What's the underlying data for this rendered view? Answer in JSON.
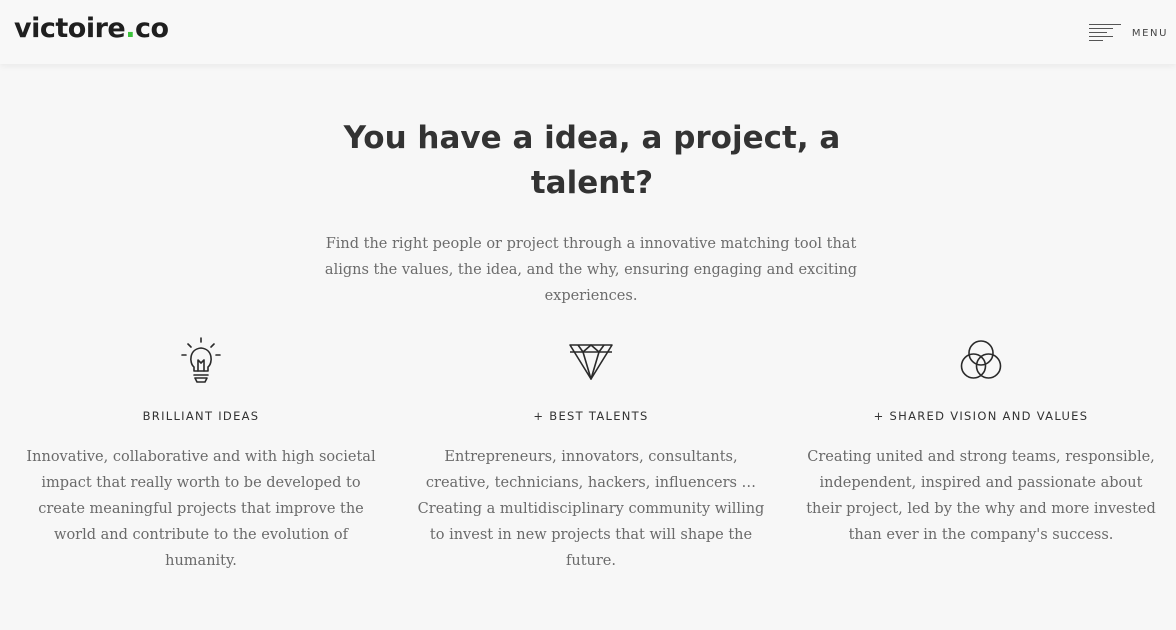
{
  "header": {
    "logo_main": "victoire",
    "logo_dot": ".",
    "logo_suffix": "co",
    "menu_label": "MENU"
  },
  "hero": {
    "title": "You have a idea, a project, a talent?",
    "subtitle": "Find the right people or project through a innovative matching tool that aligns the values, the idea, and the why, ensuring engaging and exciting experiences."
  },
  "features": [
    {
      "icon": "lightbulb-icon",
      "title": "BRILLIANT IDEAS",
      "text": "Innovative, collaborative and with high societal impact that really worth to be developed to create meaningful projects that improve the world and contribute to the evolution of humanity."
    },
    {
      "icon": "diamond-icon",
      "title": "+ BEST TALENTS",
      "text": "Entrepreneurs, innovators, consultants, creative, technicians, hackers, influencers …  Creating a multidisciplinary community willing to invest in new projects that will shape the future."
    },
    {
      "icon": "three-circles-icon",
      "title": "+ SHARED VISION AND VALUES",
      "text": "Creating united and strong teams, responsible, independent, inspired and passionate about their project, led by the why and more invested than ever in the company's success."
    }
  ],
  "colors": {
    "background": "#f7f7f7",
    "accent_dot": "#3cc33c",
    "heading": "#333333",
    "body_text": "#6a6a6a"
  }
}
